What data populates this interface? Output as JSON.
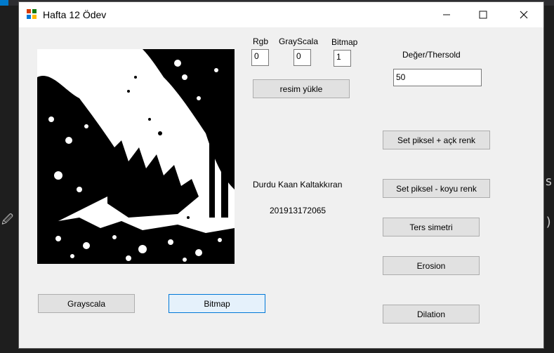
{
  "window": {
    "title": "Hafta 12 Ödev",
    "minimize_icon": "minimize-icon",
    "maximize_icon": "maximize-icon",
    "close_icon": "close-icon"
  },
  "labels": {
    "rgb": "Rgb",
    "grayscale": "GrayScala",
    "bitmap": "Bitmap",
    "threshold": "Değer/Thersold",
    "author_name": "Durdu Kaan Kaltakkıran",
    "student_id": "201913172065"
  },
  "fields": {
    "rgb_value": "0",
    "grayscale_value": "0",
    "bitmap_value": "1",
    "threshold_value": "50"
  },
  "buttons": {
    "load_image": "resim yükle",
    "set_pixel_light": "Set piksel + açk renk",
    "set_pixel_dark": "Set piksel - koyu renk",
    "mirror": "Ters simetri",
    "erosion": "Erosion",
    "dilation": "Dilation",
    "grayscale": "Grayscala",
    "bitmap": "Bitmap"
  },
  "picture": {
    "description_icon": "binary-forest-image"
  },
  "colors": {
    "window_bg": "#f0f0f0",
    "focus_border": "#0078d7",
    "button_bg": "#e1e1e1"
  }
}
